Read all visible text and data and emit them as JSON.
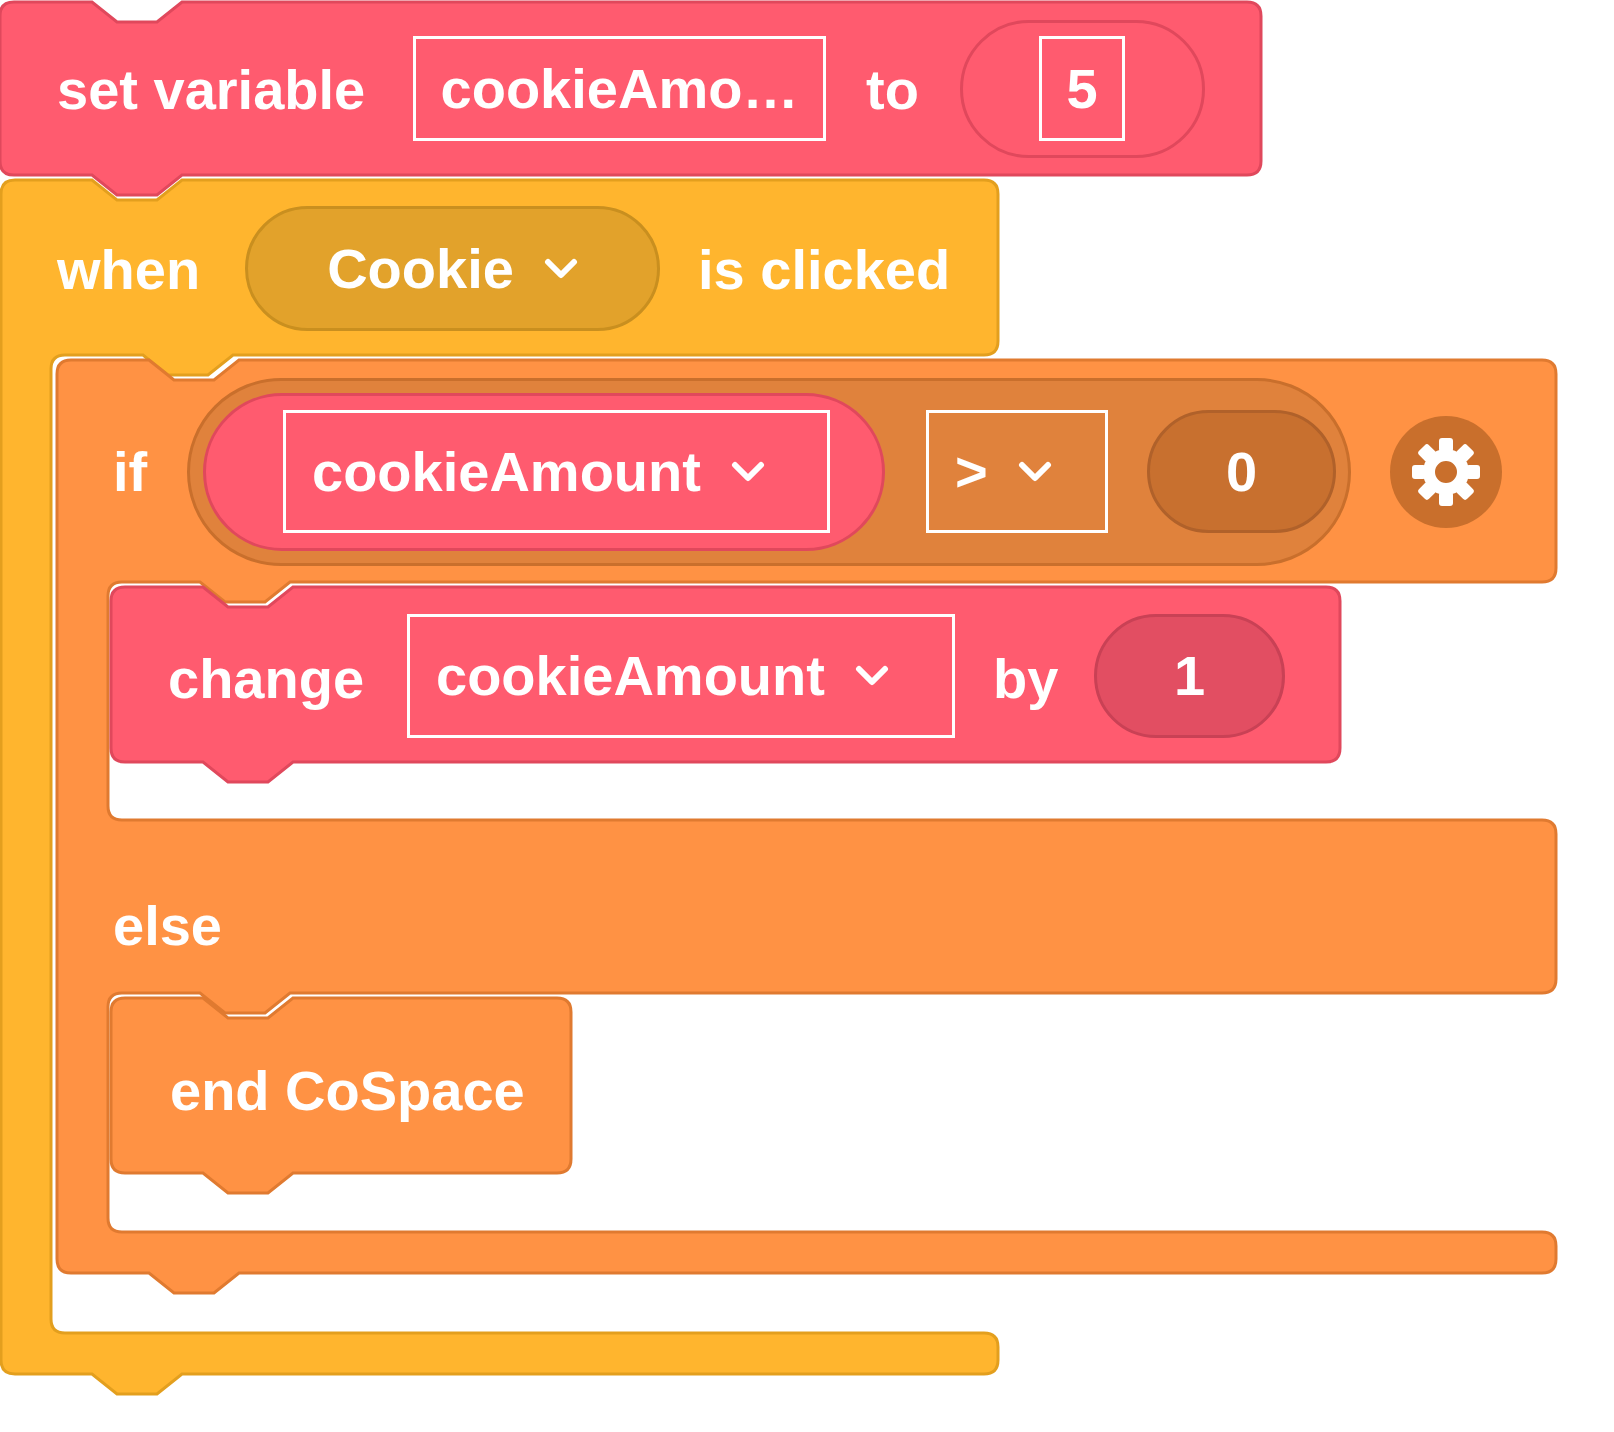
{
  "blocks": [
    {
      "kind": "set_variable",
      "label": "set variable",
      "variable": "cookieAmo…",
      "to_label": "to",
      "value": "5"
    },
    {
      "kind": "event",
      "label": "when",
      "object": "Cookie",
      "suffix": "is clicked",
      "children": [
        {
          "kind": "if_else",
          "if_label": "if",
          "condition": {
            "variable": "cookieAmount",
            "operator": ">",
            "value": "0"
          },
          "then": [
            {
              "kind": "change",
              "label": "change",
              "variable": "cookieAmount",
              "by_label": "by",
              "value": "1"
            }
          ],
          "else_label": "else",
          "else": [
            {
              "kind": "end",
              "label": "end CoSpace"
            }
          ]
        }
      ]
    }
  ]
}
